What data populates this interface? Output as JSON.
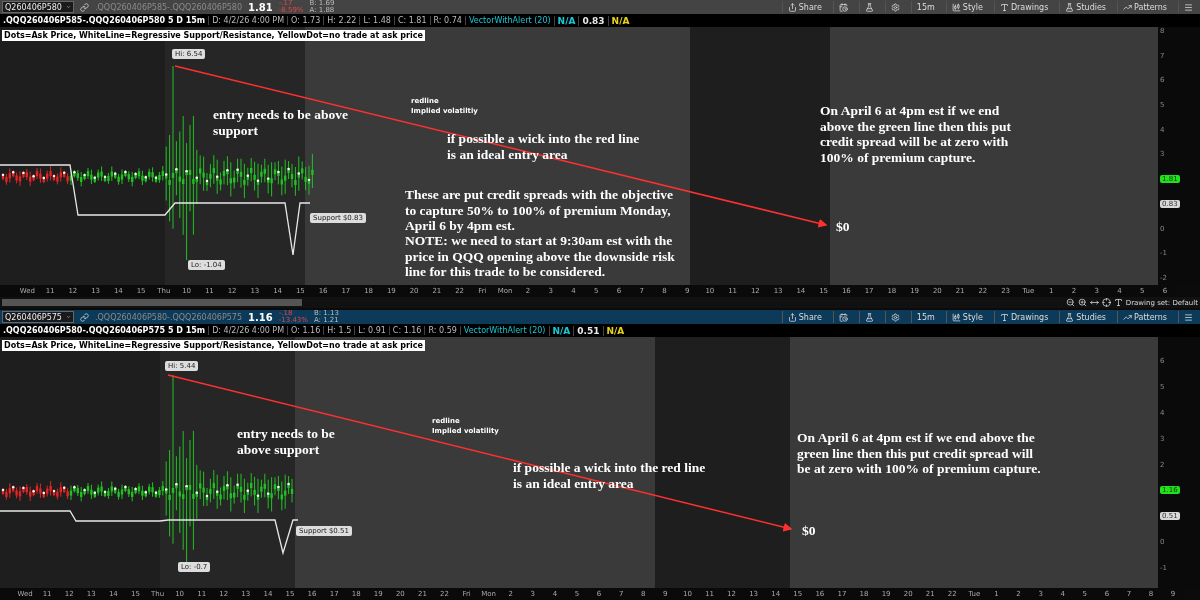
{
  "panels": [
    {
      "active": false,
      "symbol": "Q260406P580",
      "spread": ".QQQ260406P585-.QQQ260406P580",
      "last": "1.81",
      "change": "-.17",
      "change_pct": "-8.59%",
      "bid": "B: 1.69",
      "ask": "A: 1.88",
      "toolbar": [
        {
          "kind": "share",
          "label": "Share"
        },
        {
          "kind": "calendar"
        },
        {
          "kind": "flask"
        },
        {
          "kind": "gear"
        },
        {
          "kind": "interval",
          "label": "15m"
        },
        {
          "kind": "style",
          "label": "Style"
        },
        {
          "kind": "drawings",
          "label": "Drawings"
        },
        {
          "kind": "studies",
          "label": "Studies"
        },
        {
          "kind": "patterns",
          "label": "Patterns"
        },
        {
          "kind": "menu"
        }
      ],
      "info": {
        "title": ".QQQ260406P585-.QQQ260406P580 5 D 15m",
        "fields": [
          "D: 4/2/26 4:00 PM",
          "O: 1.73",
          "H: 2.22",
          "L: 1.48",
          "C: 1.81",
          "R: 0.74"
        ],
        "study": "VectorWithAlert (20)",
        "study_values": [
          {
            "text": "N/A",
            "kind": "signal"
          },
          {
            "text": "0.83",
            "kind": "value"
          },
          {
            "text": "N/A",
            "kind": "alert"
          }
        ]
      },
      "legend": "Dots=Ask Price, WhiteLine=Regressive Support/Resistance, YellowDot=no trade at ask price",
      "markers": {
        "hi": "Hi: 6.54",
        "lo": "Lo: -1.04",
        "support": "Support $0.83"
      },
      "price_labels": [
        {
          "kind": "tick",
          "text": "8"
        },
        {
          "kind": "tick",
          "text": "7"
        },
        {
          "kind": "tick",
          "text": "6"
        },
        {
          "kind": "tick",
          "text": "5"
        },
        {
          "kind": "tick",
          "text": "4"
        },
        {
          "kind": "tick",
          "text": "3"
        },
        {
          "kind": "last",
          "text": "1.81"
        },
        {
          "kind": "support",
          "text": "0.83"
        },
        {
          "kind": "tick",
          "text": "0"
        },
        {
          "kind": "tick",
          "text": "-1"
        },
        {
          "kind": "tick",
          "text": "-2"
        }
      ],
      "time_labels": [
        "Wed",
        "11",
        "12",
        "13",
        "14",
        "15",
        "Thu",
        "10",
        "11",
        "12",
        "13",
        "14",
        "15",
        "16",
        "17",
        "18",
        "19",
        "20",
        "21",
        "22",
        "Fri",
        "Mon",
        "2",
        "3",
        "4",
        "5",
        "6",
        "7",
        "8",
        "9",
        "10",
        "11",
        "12",
        "13",
        "14",
        "15",
        "16",
        "17",
        "18",
        "19",
        "20",
        "21",
        "22",
        "23",
        "Tue",
        "1",
        "2",
        "3",
        "4",
        "5",
        "6"
      ],
      "annotations": [
        {
          "kind": "note",
          "text": "entry needs to be above support"
        },
        {
          "kind": "tag",
          "text": "redline"
        },
        {
          "kind": "tag",
          "text": "Implied volatiltiy"
        },
        {
          "kind": "note",
          "text": "if possible a wick into the red line is an ideal entry area"
        },
        {
          "kind": "note",
          "text": "These are put credit spreads with the objective to capture 50% to 100% of premium Monday, April 6 by 4pm est."
        },
        {
          "kind": "note",
          "text": "NOTE: we need to start at 9:30am est with the price in QQQ opening above the downside risk line for this trade to be considered."
        },
        {
          "kind": "note",
          "text": "On April 6 at 4pm est if we end above the green line then this put credit spread will be at zero with 100% of premium capture."
        },
        {
          "kind": "note",
          "text": "$0"
        }
      ],
      "drawing_set": "Drawing set: Default"
    },
    {
      "active": true,
      "symbol": "Q260406P575",
      "spread": ".QQQ260406P580-.QQQ260406P575",
      "last": "1.16",
      "change": "-.18",
      "change_pct": "-13.43%",
      "bid": "B: 1.13",
      "ask": "A: 1.21",
      "toolbar": [
        {
          "kind": "share",
          "label": "Share"
        },
        {
          "kind": "calendar"
        },
        {
          "kind": "flask"
        },
        {
          "kind": "gear"
        },
        {
          "kind": "interval",
          "label": "15m"
        },
        {
          "kind": "style",
          "label": "Style"
        },
        {
          "kind": "drawings",
          "label": "Drawings"
        },
        {
          "kind": "studies",
          "label": "Studies"
        },
        {
          "kind": "patterns",
          "label": "Patterns"
        },
        {
          "kind": "menu"
        }
      ],
      "info": {
        "title": ".QQQ260406P580-.QQQ260406P575 5 D 15m",
        "fields": [
          "D: 4/2/26 4:00 PM",
          "O: 1.16",
          "H: 1.5",
          "L: 0.91",
          "C: 1.16",
          "R: 0.59"
        ],
        "study": "VectorWithAlert (20)",
        "study_values": [
          {
            "text": "N/A",
            "kind": "signal"
          },
          {
            "text": "0.51",
            "kind": "value"
          },
          {
            "text": "N/A",
            "kind": "alert"
          }
        ]
      },
      "legend": "Dots=Ask Price, WhiteLine=Regressive Support/Resistance, YellowDot=no trade at ask price",
      "markers": {
        "hi": "Hi: 5.44",
        "lo": "Lo: -0.7",
        "support": "Support $0.51"
      },
      "price_labels": [
        {
          "kind": "tick",
          "text": "6"
        },
        {
          "kind": "tick",
          "text": "5"
        },
        {
          "kind": "tick",
          "text": "4"
        },
        {
          "kind": "tick",
          "text": "3"
        },
        {
          "kind": "tick",
          "text": "2"
        },
        {
          "kind": "last",
          "text": "1.16"
        },
        {
          "kind": "support",
          "text": "0.51"
        },
        {
          "kind": "tick",
          "text": "0"
        },
        {
          "kind": "tick",
          "text": "-1"
        }
      ],
      "time_labels": [
        "Wed",
        "11",
        "12",
        "13",
        "14",
        "15",
        "Thu",
        "10",
        "11",
        "12",
        "13",
        "14",
        "15",
        "16",
        "17",
        "18",
        "19",
        "20",
        "21",
        "22",
        "Fri",
        "Mon",
        "2",
        "3",
        "4",
        "5",
        "6",
        "7",
        "8",
        "9",
        "10",
        "11",
        "12",
        "13",
        "14",
        "15",
        "16",
        "17",
        "18",
        "19",
        "20",
        "21",
        "22",
        "Tue",
        "1",
        "2",
        "3",
        "4",
        "5",
        "6",
        "7",
        "8",
        "9"
      ],
      "annotations": [
        {
          "kind": "note",
          "text": "entry needs to be above support"
        },
        {
          "kind": "tag",
          "text": "redline"
        },
        {
          "kind": "tag",
          "text": "Implied volatility"
        },
        {
          "kind": "note",
          "text": "if possible a wick into the red line is an ideal entry area"
        },
        {
          "kind": "note",
          "text": "On April 6 at 4pm est if we end above the green line then this put credit spread will be at zero with 100% of premium capture."
        },
        {
          "kind": "note",
          "text": "$0"
        }
      ]
    }
  ]
}
